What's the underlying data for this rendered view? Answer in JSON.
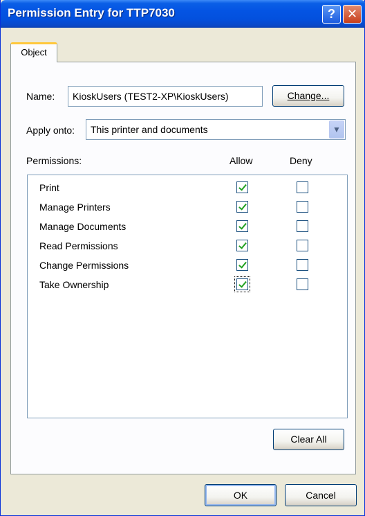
{
  "window": {
    "title": "Permission Entry for TTP7030",
    "help_glyph": "?",
    "close_glyph": "✕"
  },
  "tabs": [
    {
      "label": "Object",
      "active": true
    }
  ],
  "name_row": {
    "label": "Name:",
    "value": "KioskUsers (TEST2-XP\\KioskUsers)",
    "change_label": "Change..."
  },
  "apply_row": {
    "label": "Apply onto:",
    "value": "This printer and documents",
    "arrow_glyph": "▼"
  },
  "permissions": {
    "header_label": "Permissions:",
    "allow_header": "Allow",
    "deny_header": "Deny",
    "items": [
      {
        "name": "Print",
        "allow": true,
        "deny": false
      },
      {
        "name": "Manage Printers",
        "allow": true,
        "deny": false
      },
      {
        "name": "Manage Documents",
        "allow": true,
        "deny": false
      },
      {
        "name": "Read Permissions",
        "allow": true,
        "deny": false
      },
      {
        "name": "Change Permissions",
        "allow": true,
        "deny": false
      },
      {
        "name": "Take Ownership",
        "allow": true,
        "deny": false,
        "focused": true
      }
    ]
  },
  "buttons": {
    "clear_all": "Clear All",
    "ok": "OK",
    "cancel": "Cancel"
  },
  "colors": {
    "titlebar": "#0454e3",
    "dialog_bg": "#ece9d8",
    "check_green": "#21a121",
    "tab_highlight": "#ffc83c"
  }
}
